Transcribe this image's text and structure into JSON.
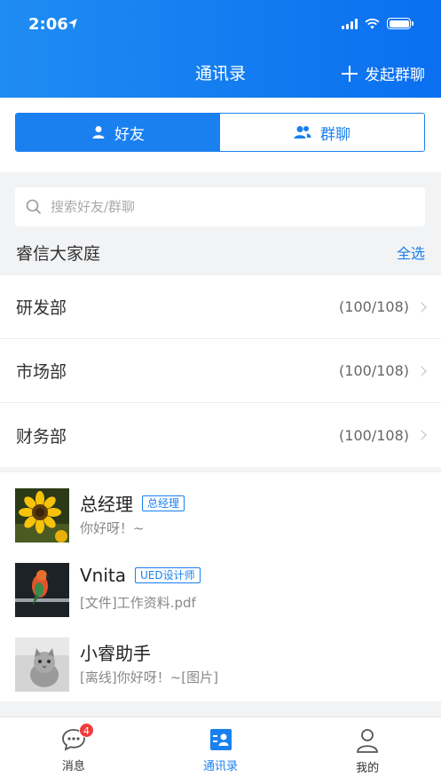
{
  "status_bar": {
    "time": "2:06"
  },
  "nav": {
    "title": "通讯录",
    "action_label": "发起群聊"
  },
  "segment": {
    "friends_label": "好友",
    "groups_label": "群聊",
    "active": "friends"
  },
  "search": {
    "placeholder": "搜索好友/群聊",
    "value": ""
  },
  "group": {
    "title": "睿信大家庭",
    "select_all": "全选"
  },
  "departments": [
    {
      "name": "研发部",
      "count": "(100/108)"
    },
    {
      "name": "市场部",
      "count": "(100/108)"
    },
    {
      "name": "财务部",
      "count": "(100/108)"
    }
  ],
  "contacts": [
    {
      "name": "总经理",
      "tag": "总经理",
      "message": "你好呀！~",
      "avatar": "sunflower-avatar"
    },
    {
      "name": "Vnita",
      "tag": "UED设计师",
      "message": "[文件]工作资料.pdf",
      "avatar": "parrot-avatar"
    },
    {
      "name": "小睿助手",
      "tag": "",
      "message": "[离线]你好呀！~[图片]",
      "avatar": "kitten-avatar"
    }
  ],
  "tabbar": {
    "messages_label": "消息",
    "messages_badge": "4",
    "contacts_label": "通讯录",
    "mine_label": "我的",
    "accent": "#1a80f0"
  }
}
